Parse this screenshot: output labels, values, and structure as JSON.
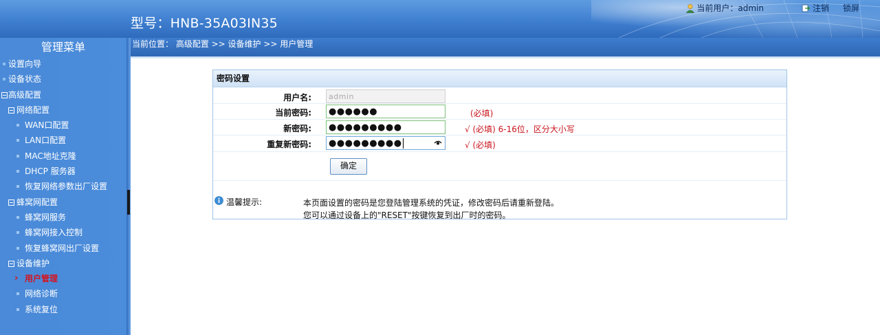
{
  "header": {
    "model_title": "型号：HNB-35A03IN35",
    "current_user_label": "当前用户：admin",
    "logout_label": "注销",
    "lock_screen_label": "锁屏"
  },
  "sidebar": {
    "title": "管理菜单",
    "items": [
      {
        "label": "设置向导"
      },
      {
        "label": "设备状态"
      },
      {
        "label": "高级配置"
      },
      {
        "label": "网络配置"
      },
      {
        "label": "WAN口配置"
      },
      {
        "label": "LAN口配置"
      },
      {
        "label": "MAC地址克隆"
      },
      {
        "label": "DHCP 服务器"
      },
      {
        "label": "恢复网络参数出厂设置"
      },
      {
        "label": "蜂窝网配置"
      },
      {
        "label": "蜂窝网服务"
      },
      {
        "label": "蜂窝网接入控制"
      },
      {
        "label": "恢复蜂窝网出厂设置"
      },
      {
        "label": "设备维护"
      },
      {
        "label": "用户管理"
      },
      {
        "label": "网络诊断"
      },
      {
        "label": "系统复位"
      }
    ]
  },
  "breadcrumb": "当前位置： 高级配置 >> 设备维护 >> 用户管理",
  "panel": {
    "title": "密码设置",
    "username_label": "用户名:",
    "username_value": "admin",
    "current_password_label": "当前密码:",
    "current_password_value": "●●●●●●",
    "current_password_hint": "(必填)",
    "new_password_label": "新密码:",
    "new_password_value": "●●●●●●●●●",
    "new_password_hint": "√ (必填) 6-16位，区分大小写",
    "repeat_password_label": "重复新密码:",
    "repeat_password_value": "●●●●●●●●●",
    "repeat_password_hint": "√ (必填)",
    "confirm_label": "确定",
    "tip_label": "温馨提示:",
    "tip_line1": "本页面设置的密码是您登陆管理系统的凭证，修改密码后请重新登陆。",
    "tip_line2": "您可以通过设备上的\"RESET\"按键恢复到出厂时的密码。"
  },
  "colors": {
    "sidebar_bg": "#4a8ad8",
    "active_item": "#d4141f",
    "hint_red": "#c8141c",
    "panel_border": "#9fc3e8"
  }
}
